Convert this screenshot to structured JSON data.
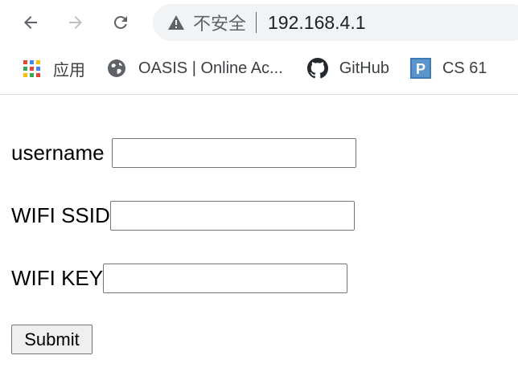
{
  "browser": {
    "security_label": "不安全",
    "url": "192.168.4.1"
  },
  "bookmarks": [
    {
      "label": "应用",
      "icon": "apps-grid-icon"
    },
    {
      "label": "OASIS | Online Ac...",
      "icon": "globe-icon"
    },
    {
      "label": "GitHub",
      "icon": "github-icon"
    },
    {
      "label": "CS 61",
      "icon": "piazza-icon"
    }
  ],
  "form": {
    "username_label": "username",
    "username_value": "",
    "ssid_label": "WIFI SSID",
    "ssid_value": "",
    "key_label": "WIFI KEY",
    "key_value": "",
    "submit_label": "Submit"
  },
  "colors": {
    "chrome_icon": "#5f6368",
    "omnibox_bg": "#f1f3f4",
    "piazza_blue": "#3d7ab8"
  }
}
